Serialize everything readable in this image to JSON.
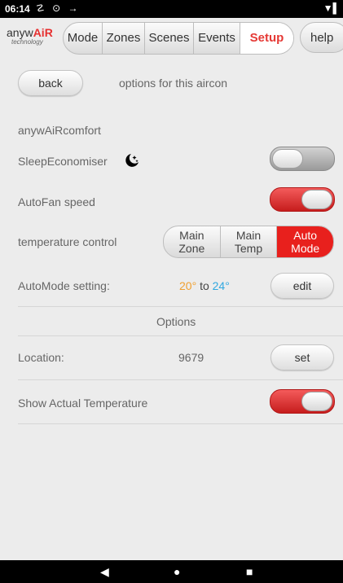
{
  "status_bar": {
    "time": "06:14",
    "left_icons": "☡ ⊙ →",
    "right_icon": "▼▌"
  },
  "logo": {
    "name_prefix": "anyw",
    "name_suffix": "AiR",
    "tagline": "technology"
  },
  "tabs": [
    {
      "label": "Mode",
      "active": false
    },
    {
      "label": "Zones",
      "active": false
    },
    {
      "label": "Scenes",
      "active": false
    },
    {
      "label": "Events",
      "active": false
    },
    {
      "label": "Setup",
      "active": true
    }
  ],
  "help_label": "help",
  "header": {
    "back_label": "back",
    "title": "options for this aircon"
  },
  "section_title": "anywAiRcomfort",
  "sleep_economiser": {
    "label": "SleepEconomiser",
    "icon": "moon-stars-icon",
    "on": false
  },
  "autofan": {
    "label": "AutoFan speed",
    "on": true
  },
  "temperature_control": {
    "label": "temperature control",
    "options": [
      {
        "line1": "Main",
        "line2": "Zone",
        "active": false
      },
      {
        "line1": "Main",
        "line2": "Temp",
        "active": false
      },
      {
        "line1": "Auto",
        "line2": "Mode",
        "active": true
      }
    ]
  },
  "automode": {
    "label": "AutoMode setting:",
    "low": "20°",
    "to": "to",
    "high": "24°",
    "edit_label": "edit",
    "low_color": "#f0a030",
    "high_color": "#30a8e0"
  },
  "options_title": "Options",
  "location": {
    "label": "Location:",
    "value": "9679",
    "set_label": "set"
  },
  "show_actual_temp": {
    "label": "Show Actual Temperature",
    "on": true
  },
  "nav_bar": {
    "back": "◀",
    "home": "●",
    "recents": "■"
  }
}
